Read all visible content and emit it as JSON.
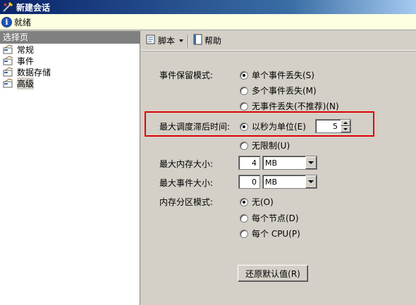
{
  "window": {
    "title": "新建会话",
    "icon": "new-session-icon"
  },
  "status": {
    "icon": "info-icon",
    "text": "就绪"
  },
  "sidebar": {
    "header": "选择页",
    "items": [
      {
        "label": "常规",
        "icon": "page-icon"
      },
      {
        "label": "事件",
        "icon": "page-icon"
      },
      {
        "label": "数据存储",
        "icon": "page-icon"
      },
      {
        "label": "高级",
        "icon": "page-icon",
        "selected": true
      }
    ]
  },
  "toolbar": {
    "script_label": "脚本",
    "help_label": "帮助"
  },
  "form": {
    "retention": {
      "label": "事件保留模式:",
      "options": [
        "单个事件丢失(S)",
        "多个事件丢失(M)",
        "无事件丢失(不推荐)(N)"
      ],
      "selected": 0
    },
    "latency": {
      "label": "最大调度滞后时间:",
      "seconds_label": "以秒为单位(E)",
      "seconds_value": "5",
      "unlimited_label": "无限制(U)",
      "selected": 0
    },
    "max_memory": {
      "label": "最大内存大小:",
      "value": "4",
      "unit": "MB"
    },
    "max_event": {
      "label": "最大事件大小:",
      "value": "0",
      "unit": "MB"
    },
    "partition": {
      "label": "内存分区模式:",
      "options": [
        "无(O)",
        "每个节点(D)",
        "每个 CPU(P)"
      ],
      "selected": 0
    },
    "restore_button": "还原默认值(R)"
  },
  "colors": {
    "highlight": "#e00000",
    "titlebar": "#0a246a",
    "status_bg": "#ffffe1"
  }
}
